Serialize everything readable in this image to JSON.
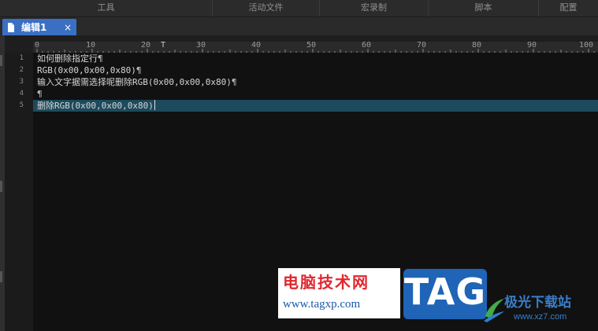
{
  "menu": {
    "items": [
      "工具",
      "活动文件",
      "宏录制",
      "脚本",
      "配置"
    ]
  },
  "tab": {
    "label": "编辑1",
    "close_glyph": "×"
  },
  "ruler": {
    "labels": [
      "0",
      "10",
      "20",
      "30",
      "40",
      "50",
      "60",
      "70",
      "80",
      "90",
      "100"
    ],
    "marker": "T"
  },
  "editor": {
    "current_line": 5,
    "lines": [
      {
        "num": "1",
        "text": "如何删除指定行",
        "mark": "¶"
      },
      {
        "num": "2",
        "text": "RGB(0x00,0x00,0x80)",
        "mark": "¶"
      },
      {
        "num": "3",
        "text": "输入文字据需选择呢删除RGB(0x00,0x00,0x80)",
        "mark": "¶"
      },
      {
        "num": "4",
        "text": "",
        "mark": "¶"
      },
      {
        "num": "5",
        "text": "删除RGB(0x00,0x00,0x80)",
        "mark": ""
      }
    ]
  },
  "watermark": {
    "title": "电脑技术网",
    "url": "www.tagxp.com",
    "tag": "TAG",
    "site_name": "极光下载站",
    "site_url": "www.xz7.com"
  },
  "colors": {
    "tab_active": "#3a6fc4",
    "current_line": "#1d4a5c",
    "editor_bg": "#111111",
    "watermark_red": "#e0282e",
    "watermark_blue": "#1f64b6"
  }
}
